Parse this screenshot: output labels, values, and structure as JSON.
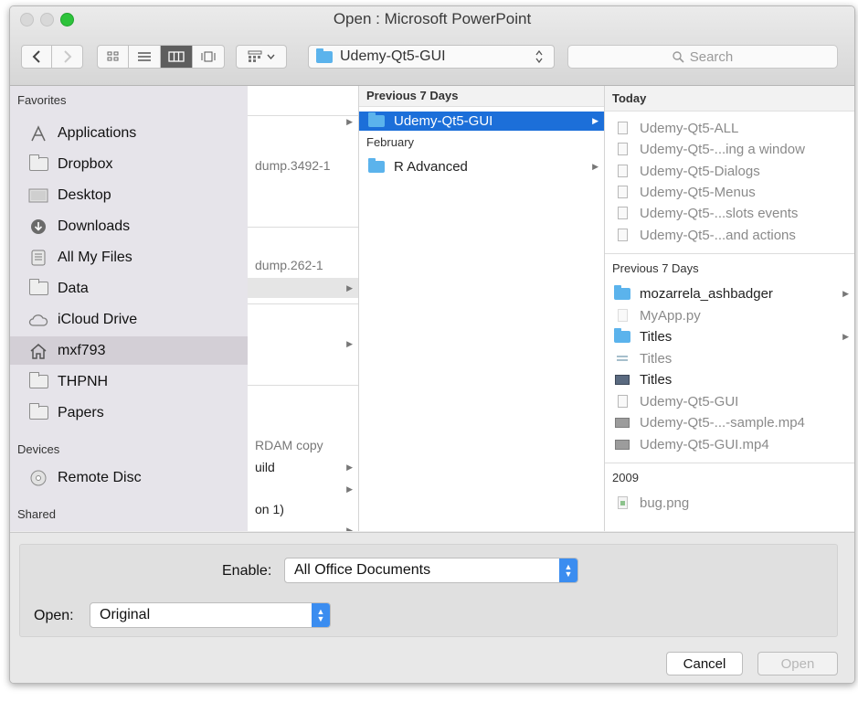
{
  "window": {
    "title": "Open : Microsoft PowerPoint"
  },
  "toolbar": {
    "back_icon": "chevron-left-icon",
    "forward_icon": "chevron-right-icon",
    "view_modes": [
      "icon-view",
      "list-view",
      "column-view",
      "cover-flow-view"
    ],
    "active_view": "column-view",
    "arrange_icon": "arrange-grid-icon",
    "path_popup": "Udemy-Qt5-GUI",
    "search_placeholder": "Search"
  },
  "sidebar": {
    "favorites_header": "Favorites",
    "favorites": [
      {
        "label": "Applications",
        "icon": "applications-icon"
      },
      {
        "label": "Dropbox",
        "icon": "folder-icon"
      },
      {
        "label": "Desktop",
        "icon": "desktop-icon"
      },
      {
        "label": "Downloads",
        "icon": "downloads-icon"
      },
      {
        "label": "All My Files",
        "icon": "all-files-icon"
      },
      {
        "label": "Data",
        "icon": "folder-icon"
      },
      {
        "label": "iCloud Drive",
        "icon": "cloud-icon"
      },
      {
        "label": "mxf793",
        "icon": "home-icon",
        "selected": true
      },
      {
        "label": "THPNH",
        "icon": "folder-icon"
      },
      {
        "label": "Papers",
        "icon": "folder-icon"
      }
    ],
    "devices_header": "Devices",
    "devices": [
      {
        "label": "Remote Disc",
        "icon": "disc-icon"
      }
    ],
    "shared_header": "Shared"
  },
  "column1": {
    "fragments": [
      "dump.3492-1",
      "dump.262-1",
      "RDAM copy",
      "uild",
      "on 1)"
    ]
  },
  "column2": {
    "sections": [
      {
        "header": "Previous 7 Days",
        "items": [
          {
            "label": "Udemy-Qt5-GUI",
            "kind": "folder",
            "selected": true
          }
        ]
      },
      {
        "header": "February",
        "items": [
          {
            "label": "R Advanced",
            "kind": "folder"
          }
        ]
      }
    ]
  },
  "column3": {
    "today_header": "Today",
    "today": [
      "Udemy-Qt5-ALL",
      "Udemy-Qt5-...ing a window",
      "Udemy-Qt5-Dialogs",
      "Udemy-Qt5-Menus",
      "Udemy-Qt5-...slots events",
      "Udemy-Qt5-...and actions"
    ],
    "prev7_header": "Previous 7 Days",
    "prev7": [
      {
        "label": "mozarrela_ashbadger",
        "kind": "folder",
        "enabled": true
      },
      {
        "label": "MyApp.py",
        "kind": "doc",
        "enabled": false
      },
      {
        "label": "Titles",
        "kind": "folder",
        "enabled": true
      },
      {
        "label": "Titles",
        "kind": "doc",
        "enabled": false
      },
      {
        "label": "Titles",
        "kind": "image",
        "enabled": true
      },
      {
        "label": "Udemy-Qt5-GUI",
        "kind": "doc",
        "enabled": false
      },
      {
        "label": "Udemy-Qt5-...-sample.mp4",
        "kind": "video",
        "enabled": false
      },
      {
        "label": "Udemy-Qt5-GUI.mp4",
        "kind": "video",
        "enabled": false
      }
    ],
    "y2009_header": "2009",
    "y2009": [
      {
        "label": "bug.png",
        "kind": "image",
        "enabled": false
      }
    ]
  },
  "bottom": {
    "enable_label": "Enable:",
    "enable_value": "All Office Documents",
    "open_label": "Open:",
    "open_value": "Original",
    "cancel_label": "Cancel",
    "open_button_label": "Open"
  },
  "colors": {
    "selection": "#1c6fd9",
    "folder": "#5bb3ec",
    "stepper": "#3b8df0",
    "close_green": "#2dc33b"
  }
}
